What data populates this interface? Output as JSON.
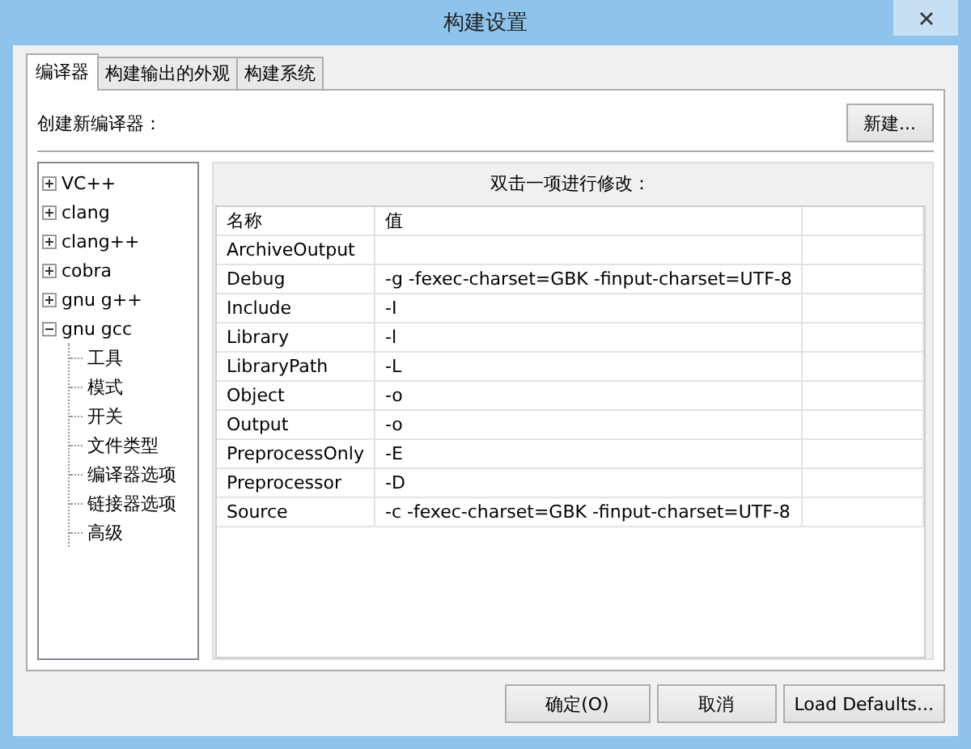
{
  "window": {
    "title": "构建设置"
  },
  "tabs": [
    {
      "label": "编译器",
      "selected": true
    },
    {
      "label": "构建输出的外观",
      "selected": false
    },
    {
      "label": "构建系统",
      "selected": false
    }
  ],
  "create_label": "创建新编译器：",
  "new_button": "新建...",
  "tree": [
    {
      "label": "VC++",
      "expanded": false
    },
    {
      "label": "clang",
      "expanded": false
    },
    {
      "label": "clang++",
      "expanded": false
    },
    {
      "label": "cobra",
      "expanded": false
    },
    {
      "label": "gnu g++",
      "expanded": false
    },
    {
      "label": "gnu gcc",
      "expanded": true,
      "children": [
        {
          "label": "工具"
        },
        {
          "label": "模式"
        },
        {
          "label": "开关"
        },
        {
          "label": "文件类型"
        },
        {
          "label": "编译器选项"
        },
        {
          "label": "链接器选项"
        },
        {
          "label": "高级"
        }
      ]
    }
  ],
  "hint": "双击一项进行修改：",
  "table": {
    "columns": [
      "名称",
      "值"
    ],
    "rows": [
      [
        "ArchiveOutput",
        ""
      ],
      [
        "Debug",
        "-g -fexec-charset=GBK -finput-charset=UTF-8"
      ],
      [
        "Include",
        "-I"
      ],
      [
        "Library",
        "-l"
      ],
      [
        "LibraryPath",
        "-L"
      ],
      [
        "Object",
        "-o"
      ],
      [
        "Output",
        "-o"
      ],
      [
        "PreprocessOnly",
        "-E"
      ],
      [
        "Preprocessor",
        "-D"
      ],
      [
        "Source",
        "-c -fexec-charset=GBK -finput-charset=UTF-8"
      ]
    ]
  },
  "buttons": [
    "确定(O)",
    "取消",
    "Load Defaults..."
  ]
}
